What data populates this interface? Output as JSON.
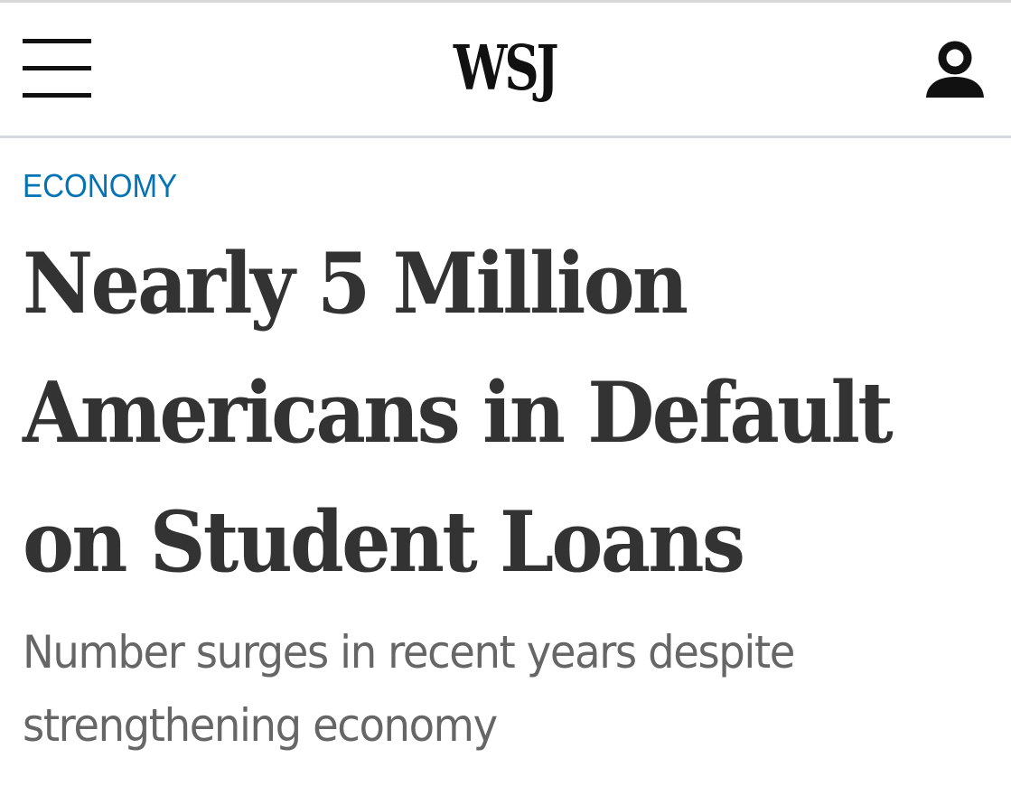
{
  "header": {
    "logo_text": "WSJ",
    "menu_icon": "hamburger-menu-icon",
    "account_icon": "user-account-icon"
  },
  "article": {
    "section": "ECONOMY",
    "headline_lines": [
      "Nearly 5 Million",
      "Americans in Default",
      "on Student Loans"
    ],
    "dek_lines": [
      "Number surges in recent years despite",
      "strengthening economy"
    ]
  },
  "colors": {
    "section_link": "#0274b6",
    "headline": "#333333",
    "dek": "#666666",
    "logo": "#111111",
    "divider": "#d6d9dc"
  }
}
